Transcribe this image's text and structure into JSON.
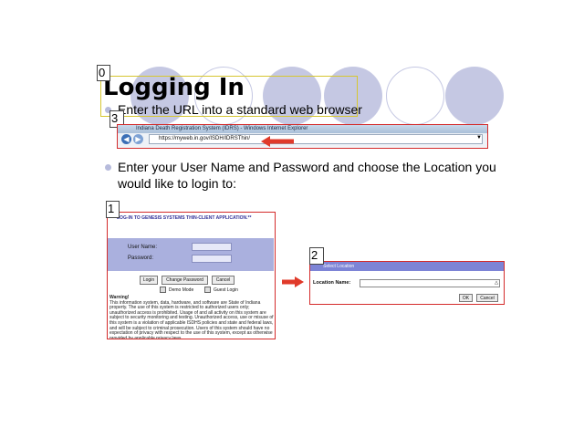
{
  "slide": {
    "title": "Logging In",
    "bullet1": "Enter the URL into a standard web browser",
    "bullet2_line1": "Enter your User Name and Password and choose the Location you",
    "bullet2_line2": "would like to login to:",
    "labels": [
      "0",
      "3",
      "1",
      "2"
    ],
    "accent_color": "#c5c8e3",
    "highlight_color": "#d42b2b"
  },
  "browser": {
    "window_title": "Indiana Death Registration System (IDRS) - Windows Internet Explorer",
    "url": "https://myweb.in.gov/ISDH/IDRSThin/"
  },
  "login": {
    "header": "LOG-IN TO GENESIS SYSTEMS THIN-CLIENT APPLICATION.**",
    "username_label": "User Name:",
    "password_label": "Password:",
    "username_value": "",
    "login_button": "Login",
    "change_password_button": "Change Password",
    "cancel_button": "Cancel",
    "demo_mode": "Demo Mode",
    "guest_login": "Guest Login",
    "warning_title": "Warning!",
    "warning_text": "This information system, data, hardware, and software are State of Indiana property. The use of this system is restricted to authorized users only; unauthorized access is prohibited. Usage of and all activity on this system are subject to security monitoring and testing. Unauthorized access, use or misuse of this system is a violation of applicable ISDHS policies and state and federal laws, and will be subject to criminal prosecution. Users of this system should have no expectation of privacy with respect to the use of this system, except as otherwise provided by applicable privacy laws."
  },
  "location": {
    "title": "Select Location",
    "label": "Location Name:",
    "ok_button": "OK",
    "cancel_button": "Cancel"
  }
}
